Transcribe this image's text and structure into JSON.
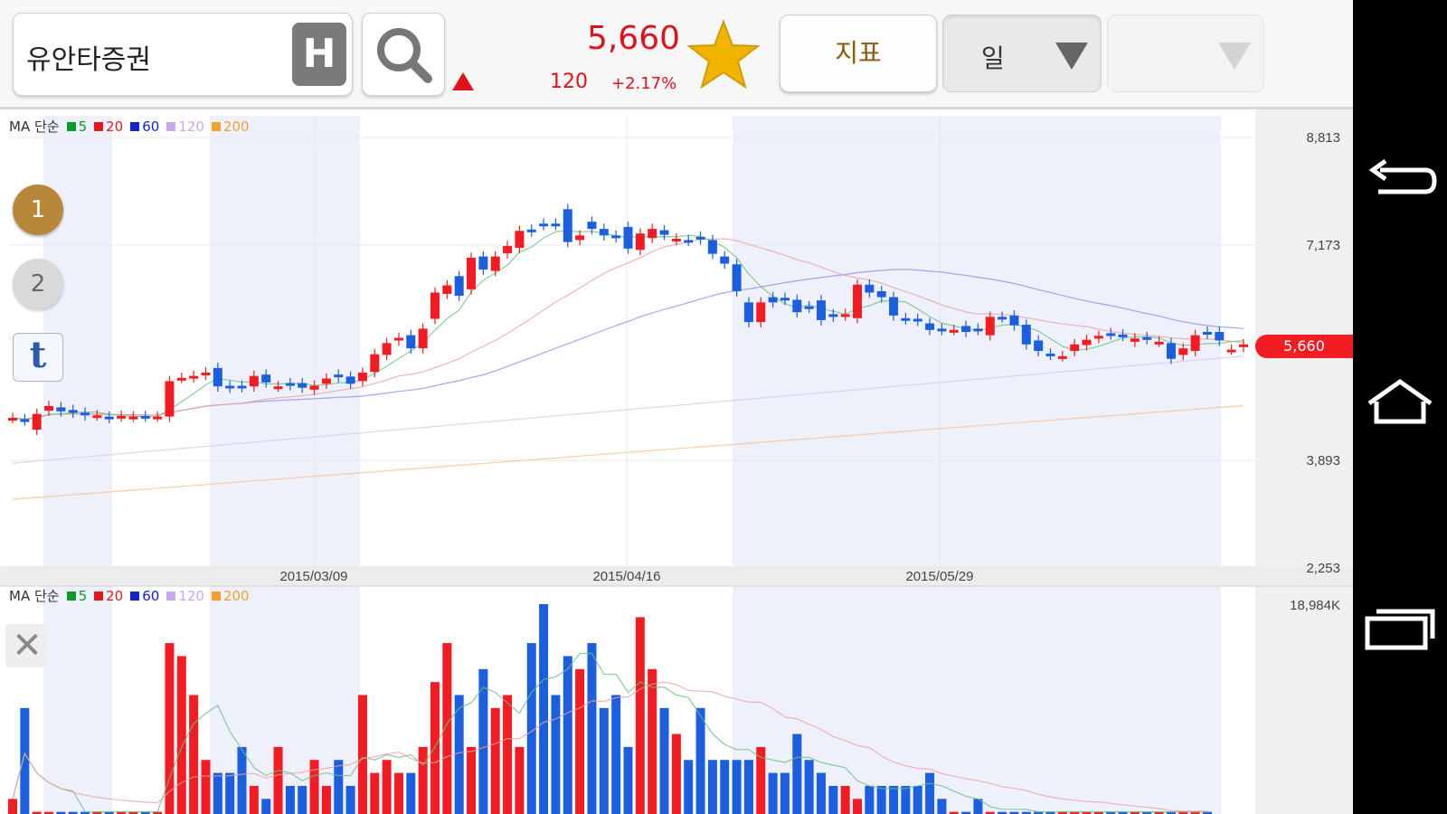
{
  "header": {
    "stock_name": "유안타증권",
    "h_label": "H",
    "price": "5,660",
    "change": "120",
    "change_pct": "+2.17%",
    "indicator_label": "지표",
    "period_label": "일"
  },
  "controls": {
    "layout1": "1",
    "layout2": "2",
    "twitter": "t",
    "close": "✕"
  },
  "price_panel": {
    "legend_ma": "MA 단순",
    "legend_items": [
      {
        "label": "5",
        "color": "#0a9a2a"
      },
      {
        "label": "20",
        "color": "#e31a1a"
      },
      {
        "label": "60",
        "color": "#1225c9"
      },
      {
        "label": "120",
        "color": "#c8a8f0"
      },
      {
        "label": "200",
        "color": "#f5a030"
      }
    ],
    "y_ticks": [
      "8,813",
      "7,173",
      "3,893",
      "2,253"
    ],
    "current_tag": "5,660",
    "x_ticks": [
      "2015/03/09",
      "2015/04/16",
      "2015/05/29"
    ]
  },
  "volume_panel": {
    "legend_ma": "MA 단순",
    "legend_items": [
      {
        "label": "5",
        "color": "#0a9a2a"
      },
      {
        "label": "20",
        "color": "#e31a1a"
      },
      {
        "label": "60",
        "color": "#1225c9"
      },
      {
        "label": "120",
        "color": "#c8a8f0"
      },
      {
        "label": "200",
        "color": "#f5a030"
      }
    ],
    "max_label": "18,984K"
  },
  "colors": {
    "up": "#f21c22",
    "down": "#1b5fe0",
    "accent_gold": "#f0b400"
  },
  "chart_data": {
    "type": "candlestick",
    "y_axis_ticks": [
      8813,
      7173,
      3893,
      2253
    ],
    "x_axis_ticks": [
      "2015/03/09",
      "2015/04/16",
      "2015/05/29"
    ],
    "last_price": 5660,
    "candles": [
      {
        "o": 4540,
        "c": 4540
      },
      {
        "o": 4520,
        "c": 4500
      },
      {
        "o": 4360,
        "c": 4600
      },
      {
        "o": 4650,
        "c": 4720
      },
      {
        "o": 4700,
        "c": 4640
      },
      {
        "o": 4660,
        "c": 4620
      },
      {
        "o": 4620,
        "c": 4580
      },
      {
        "o": 4580,
        "c": 4580
      },
      {
        "o": 4560,
        "c": 4540
      },
      {
        "o": 4560,
        "c": 4570
      },
      {
        "o": 4560,
        "c": 4560
      },
      {
        "o": 4570,
        "c": 4560
      },
      {
        "o": 4560,
        "c": 4560
      },
      {
        "o": 4560,
        "c": 5100
      },
      {
        "o": 5150,
        "c": 5150
      },
      {
        "o": 5160,
        "c": 5180
      },
      {
        "o": 5200,
        "c": 5230
      },
      {
        "o": 5300,
        "c": 5020
      },
      {
        "o": 5030,
        "c": 5000
      },
      {
        "o": 5030,
        "c": 5010
      },
      {
        "o": 5020,
        "c": 5180
      },
      {
        "o": 5200,
        "c": 5080
      },
      {
        "o": 5020,
        "c": 5020
      },
      {
        "o": 5070,
        "c": 5040
      },
      {
        "o": 5070,
        "c": 5000
      },
      {
        "o": 4970,
        "c": 5030
      },
      {
        "o": 5060,
        "c": 5140
      },
      {
        "o": 5200,
        "c": 5160
      },
      {
        "o": 5170,
        "c": 5060
      },
      {
        "o": 5100,
        "c": 5230
      },
      {
        "o": 5240,
        "c": 5510
      },
      {
        "o": 5500,
        "c": 5680
      },
      {
        "o": 5720,
        "c": 5760
      },
      {
        "o": 5800,
        "c": 5600
      },
      {
        "o": 5600,
        "c": 5900
      },
      {
        "o": 6050,
        "c": 6450
      },
      {
        "o": 6430,
        "c": 6560
      },
      {
        "o": 6700,
        "c": 6400
      },
      {
        "o": 6500,
        "c": 6980
      },
      {
        "o": 7000,
        "c": 6800
      },
      {
        "o": 6780,
        "c": 7000
      },
      {
        "o": 7050,
        "c": 7160
      },
      {
        "o": 7130,
        "c": 7390
      },
      {
        "o": 7410,
        "c": 7380
      },
      {
        "o": 7500,
        "c": 7480
      },
      {
        "o": 7500,
        "c": 7480
      },
      {
        "o": 7720,
        "c": 7220
      },
      {
        "o": 7250,
        "c": 7320
      },
      {
        "o": 7530,
        "c": 7420
      },
      {
        "o": 7420,
        "c": 7320
      },
      {
        "o": 7320,
        "c": 7290
      },
      {
        "o": 7450,
        "c": 7120
      },
      {
        "o": 7100,
        "c": 7350
      },
      {
        "o": 7280,
        "c": 7420
      },
      {
        "o": 7400,
        "c": 7330
      },
      {
        "o": 7250,
        "c": 7270
      },
      {
        "o": 7250,
        "c": 7240
      },
      {
        "o": 7300,
        "c": 7260
      },
      {
        "o": 7250,
        "c": 7040
      },
      {
        "o": 7000,
        "c": 6890
      },
      {
        "o": 6880,
        "c": 6470
      },
      {
        "o": 6300,
        "c": 6000
      },
      {
        "o": 6000,
        "c": 6300
      },
      {
        "o": 6380,
        "c": 6300
      },
      {
        "o": 6370,
        "c": 6340
      },
      {
        "o": 6340,
        "c": 6150
      },
      {
        "o": 6240,
        "c": 6220
      },
      {
        "o": 6330,
        "c": 6030
      },
      {
        "o": 6120,
        "c": 6080
      },
      {
        "o": 6100,
        "c": 6120
      },
      {
        "o": 6060,
        "c": 6570
      },
      {
        "o": 6570,
        "c": 6450
      },
      {
        "o": 6470,
        "c": 6380
      },
      {
        "o": 6380,
        "c": 6100
      },
      {
        "o": 6060,
        "c": 6040
      },
      {
        "o": 6050,
        "c": 6020
      },
      {
        "o": 5980,
        "c": 5880
      },
      {
        "o": 5900,
        "c": 5880
      },
      {
        "o": 5880,
        "c": 5880
      },
      {
        "o": 5940,
        "c": 5850
      },
      {
        "o": 5900,
        "c": 5880
      },
      {
        "o": 5800,
        "c": 6080
      },
      {
        "o": 6080,
        "c": 6070
      },
      {
        "o": 6100,
        "c": 5950
      },
      {
        "o": 5960,
        "c": 5660
      },
      {
        "o": 5720,
        "c": 5560
      },
      {
        "o": 5520,
        "c": 5500
      },
      {
        "o": 5480,
        "c": 5480
      },
      {
        "o": 5560,
        "c": 5660
      },
      {
        "o": 5650,
        "c": 5730
      },
      {
        "o": 5760,
        "c": 5790
      },
      {
        "o": 5830,
        "c": 5810
      },
      {
        "o": 5810,
        "c": 5790
      },
      {
        "o": 5700,
        "c": 5750
      },
      {
        "o": 5770,
        "c": 5740
      },
      {
        "o": 5700,
        "c": 5700
      },
      {
        "o": 5680,
        "c": 5440
      },
      {
        "o": 5500,
        "c": 5600
      },
      {
        "o": 5560,
        "c": 5800
      },
      {
        "o": 5850,
        "c": 5820
      },
      {
        "o": 5850,
        "c": 5720
      },
      {
        "o": 5580,
        "c": 5580
      },
      {
        "o": 5620,
        "c": 5660
      }
    ],
    "volume": [
      2,
      9,
      1,
      1,
      1,
      1,
      1,
      1,
      1,
      1,
      1,
      1,
      1,
      14,
      13,
      10,
      5,
      4,
      4,
      6,
      3,
      2,
      6,
      3,
      3,
      5,
      3,
      5,
      3,
      10,
      4,
      5,
      4,
      4,
      6,
      11,
      14,
      10,
      6,
      12,
      9,
      10,
      6,
      14,
      17,
      10,
      13,
      12,
      14,
      9,
      10,
      6,
      16,
      12,
      9,
      7,
      5,
      9,
      5,
      5,
      5,
      5,
      6,
      4,
      4,
      7,
      5,
      4,
      3,
      3,
      2,
      3,
      3,
      3,
      3,
      3,
      4,
      2,
      1,
      1,
      2,
      1,
      1,
      1,
      1,
      1,
      1,
      1,
      1,
      1,
      1,
      1,
      1,
      1,
      1,
      1,
      1,
      1,
      1,
      1
    ]
  }
}
